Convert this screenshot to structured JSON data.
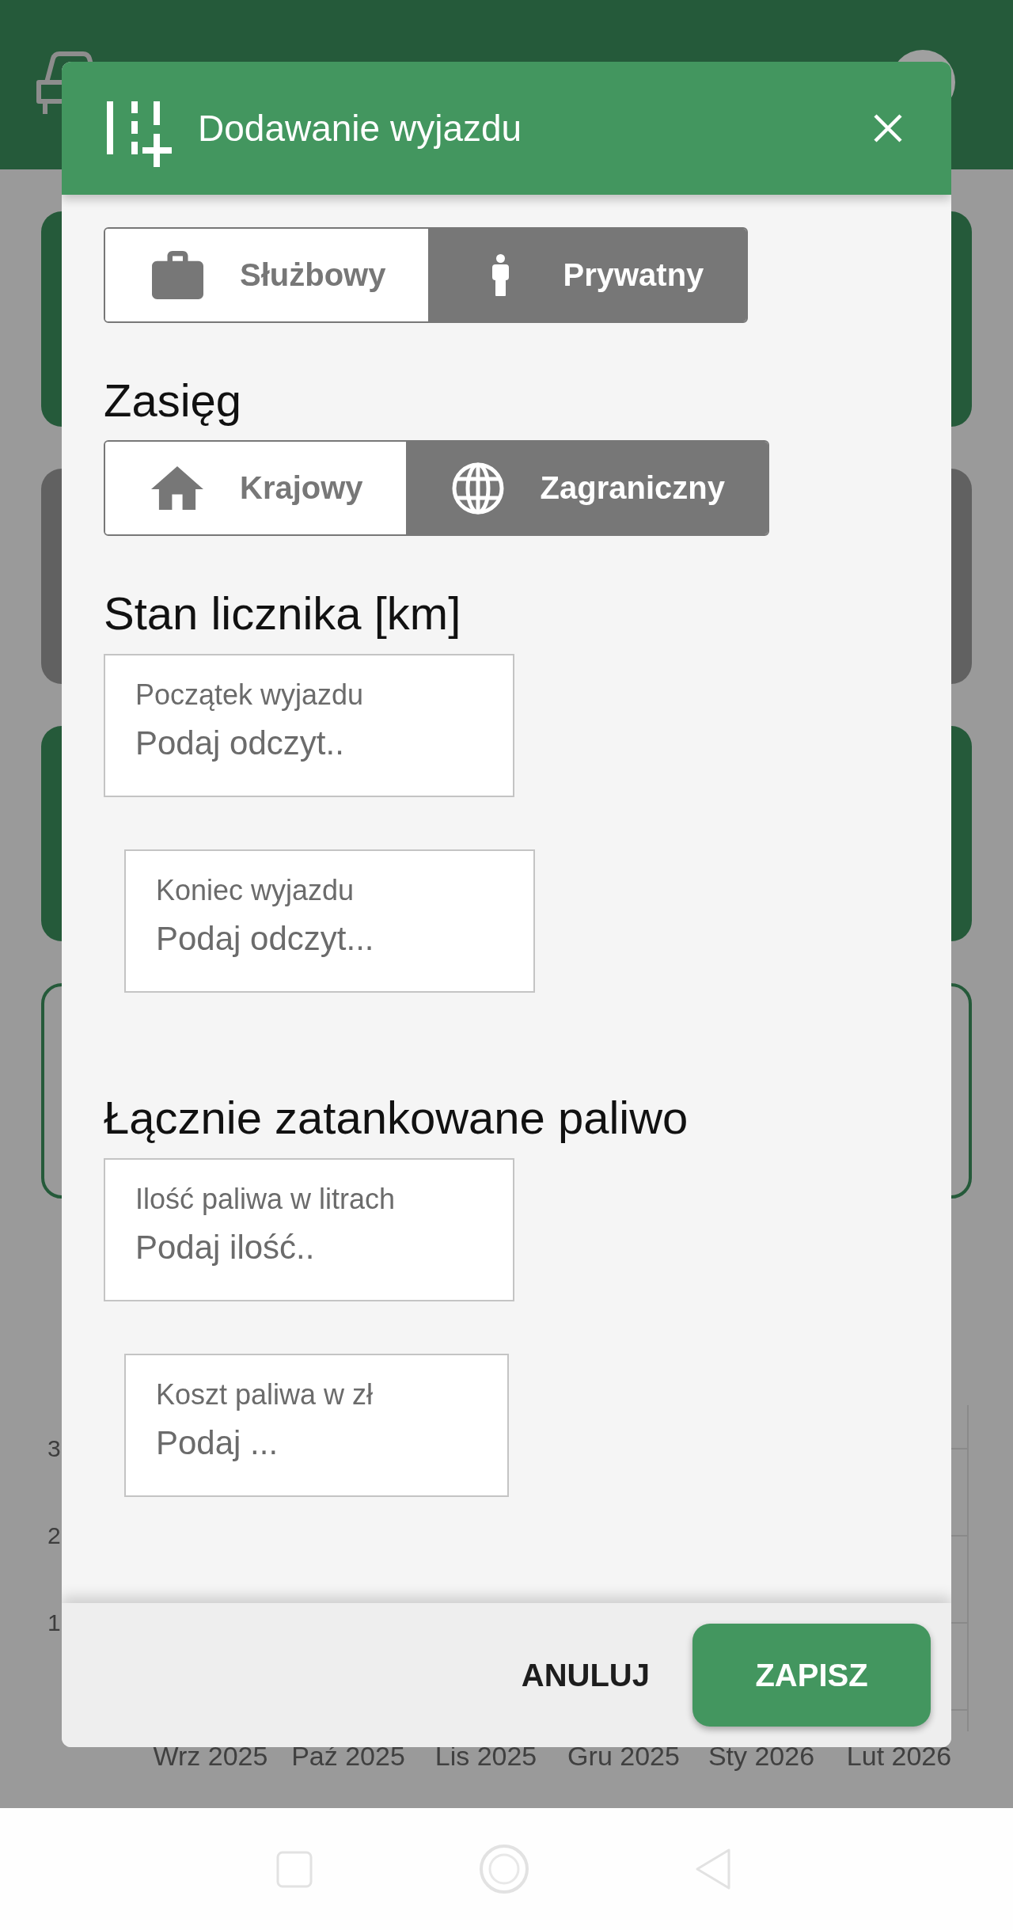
{
  "background": {
    "cards": [
      {
        "kind": "filled",
        "color": "#255a3a"
      },
      {
        "kind": "filled",
        "color": "#616161"
      },
      {
        "kind": "filled",
        "color": "#255a3a"
      },
      {
        "kind": "outlined",
        "color": "#255a3a"
      }
    ],
    "chart": {
      "y_labels": [
        "3",
        "2",
        "1"
      ],
      "x_labels": [
        "Wrz 2025",
        "Paź 2025",
        "Lis 2025",
        "Gru 2025",
        "Sty 2026",
        "Lut 2026"
      ]
    }
  },
  "dialog": {
    "title": "Dodawanie wyjazdu",
    "trip_type": {
      "options": [
        {
          "label": "Służbowy",
          "selected": false
        },
        {
          "label": "Prywatny",
          "selected": true
        }
      ]
    },
    "scope": {
      "heading": "Zasięg",
      "options": [
        {
          "label": "Krajowy",
          "selected": false
        },
        {
          "label": "Zagraniczny",
          "selected": true
        }
      ]
    },
    "odometer": {
      "heading": "Stan licznika [km]",
      "fields": [
        {
          "label": "Początek wyjazdu",
          "placeholder": "Podaj odczyt.."
        },
        {
          "label": "Koniec wyjazdu",
          "placeholder": "Podaj odczyt..."
        }
      ]
    },
    "fuel": {
      "heading": "Łącznie zatankowane paliwo",
      "fields": [
        {
          "label": "Ilość paliwa w litrach",
          "placeholder": "Podaj ilość.."
        },
        {
          "label": "Koszt paliwa w zł",
          "placeholder": "Podaj ..."
        }
      ]
    },
    "actions": [
      {
        "label": "ANULUJ",
        "kind": "text"
      },
      {
        "label": "ZAPISZ",
        "kind": "primary"
      }
    ]
  }
}
